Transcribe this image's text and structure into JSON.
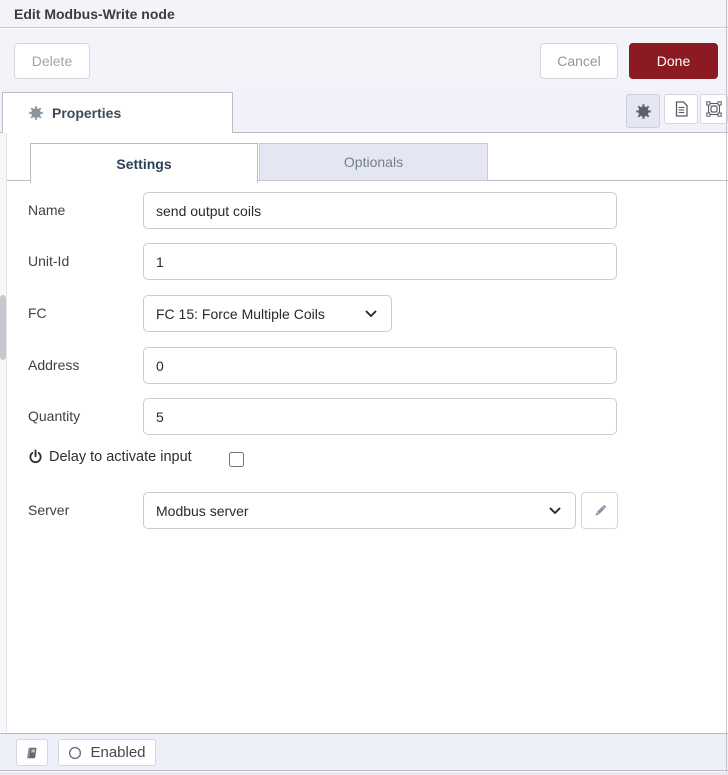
{
  "window": {
    "title": "Edit Modbus-Write node"
  },
  "toolbar": {
    "delete": "Delete",
    "cancel": "Cancel",
    "done": "Done"
  },
  "properties_tab": {
    "label": "Properties"
  },
  "form_tabs": {
    "settings": "Settings",
    "optionals": "Optionals"
  },
  "fields": {
    "name": {
      "label": "Name",
      "value": "send output coils"
    },
    "unit_id": {
      "label": "Unit-Id",
      "value": "1"
    },
    "fc": {
      "label": "FC",
      "value": "FC 15: Force Multiple Coils"
    },
    "address": {
      "label": "Address",
      "value": "0"
    },
    "quantity": {
      "label": "Quantity",
      "value": "5"
    },
    "delay_to_activate": {
      "label": "Delay to activate input",
      "checked": false
    },
    "server": {
      "label": "Server",
      "value": "Modbus server"
    }
  },
  "footer": {
    "enabled": "Enabled"
  },
  "icons": {
    "properties": "gear-icon",
    "description": "document-icon",
    "appearance": "appearance-icon",
    "delay": "power-icon",
    "edit_server": "pencil-icon",
    "library": "book-icon",
    "enabled_state": "circle-icon"
  },
  "colors": {
    "done_red": "#8c1a22",
    "panel_bg": "#f3f3fa",
    "footer_bg": "#eef0f9"
  }
}
